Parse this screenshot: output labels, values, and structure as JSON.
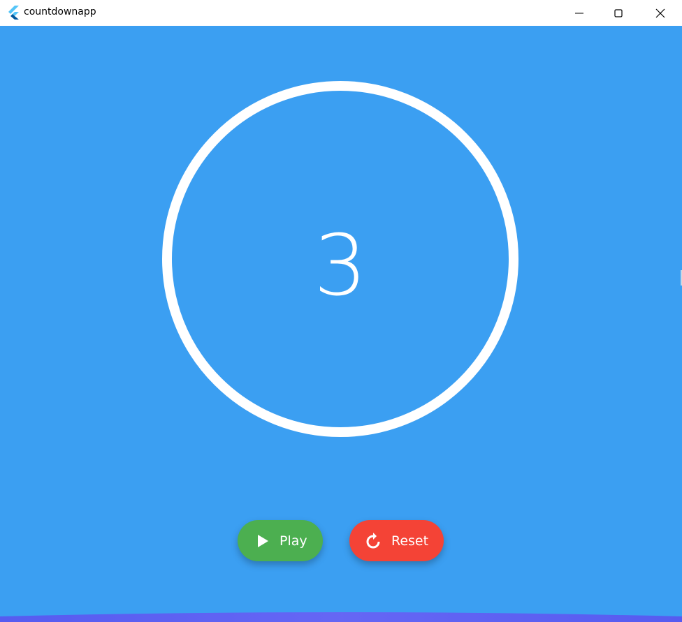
{
  "window": {
    "title": "countdownapp"
  },
  "timer": {
    "count": "3"
  },
  "controls": {
    "play_label": "Play",
    "reset_label": "Reset"
  },
  "colors": {
    "background": "#3b9ff2",
    "play": "#4caf50",
    "reset": "#f44336",
    "ring": "#ffffff"
  },
  "icons": {
    "app": "flutter-logo-icon",
    "play": "play-icon",
    "reset": "refresh-icon"
  }
}
